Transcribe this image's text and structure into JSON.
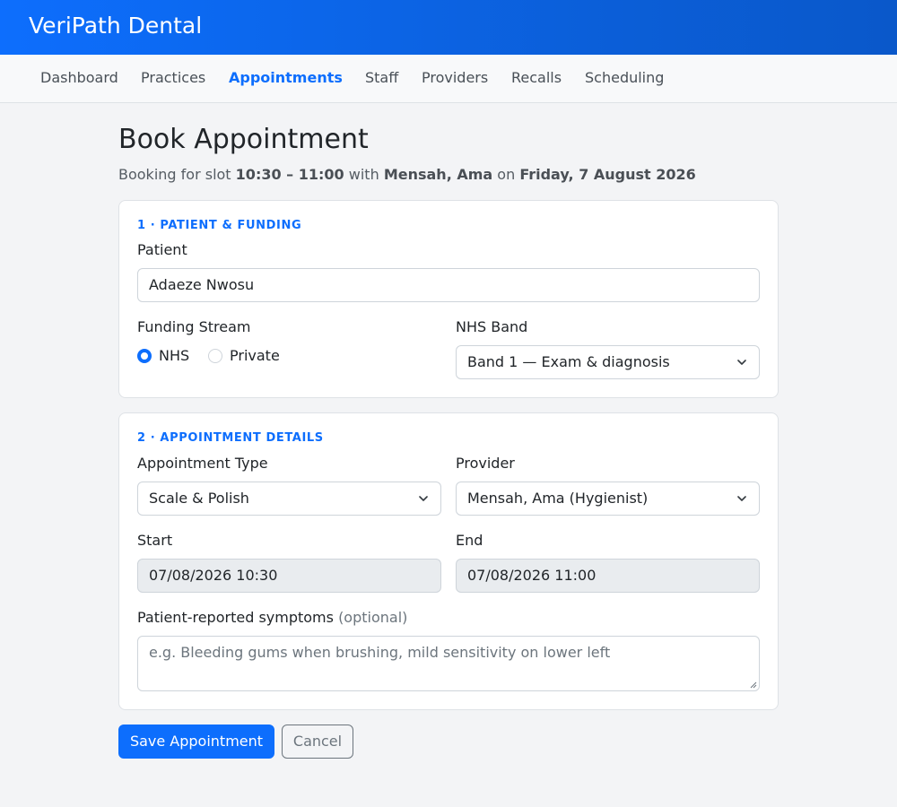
{
  "app": {
    "brand": "VeriPath Dental"
  },
  "nav": {
    "items": [
      {
        "label": "Dashboard"
      },
      {
        "label": "Practices"
      },
      {
        "label": "Appointments"
      },
      {
        "label": "Staff"
      },
      {
        "label": "Providers"
      },
      {
        "label": "Recalls"
      },
      {
        "label": "Scheduling"
      }
    ],
    "active": "Appointments"
  },
  "page": {
    "title": "Book Appointment",
    "subtitle": {
      "prefix": "Booking for slot",
      "slot": "10:30 – 11:00",
      "with": "with",
      "provider": "Mensah, Ama",
      "on": "on",
      "date": "Friday, 7 August 2026"
    }
  },
  "section1": {
    "heading": "1 · PATIENT & FUNDING",
    "patient": {
      "label": "Patient",
      "value": "Adaeze Nwosu"
    },
    "funding": {
      "label": "Funding Stream",
      "options": [
        {
          "label": "NHS",
          "checked": true
        },
        {
          "label": "Private",
          "checked": false
        }
      ]
    },
    "nhs_band": {
      "label": "NHS Band",
      "value": "Band 1 — Exam & diagnosis"
    }
  },
  "section2": {
    "heading": "2 · APPOINTMENT DETAILS",
    "appointment_type": {
      "label": "Appointment Type",
      "value": "Scale & Polish"
    },
    "provider": {
      "label": "Provider",
      "value": "Mensah, Ama (Hygienist)"
    },
    "start": {
      "label": "Start",
      "value": "07/08/2026 10:30"
    },
    "end": {
      "label": "End",
      "value": "07/08/2026 11:00"
    },
    "symptoms": {
      "label": "Patient-reported symptoms",
      "optional": "(optional)",
      "placeholder": "e.g. Bleeding gums when brushing, mild sensitivity on lower left"
    }
  },
  "actions": {
    "save_label": "Save Appointment",
    "cancel_label": "Cancel"
  },
  "icons": {
    "select_chevron": "chevron-down-icon",
    "textarea_resize": "resize-grip-icon"
  },
  "colors": {
    "accent": "#0d6efd",
    "header": "#0b5ed7",
    "page_bg": "#f3f4f6"
  }
}
